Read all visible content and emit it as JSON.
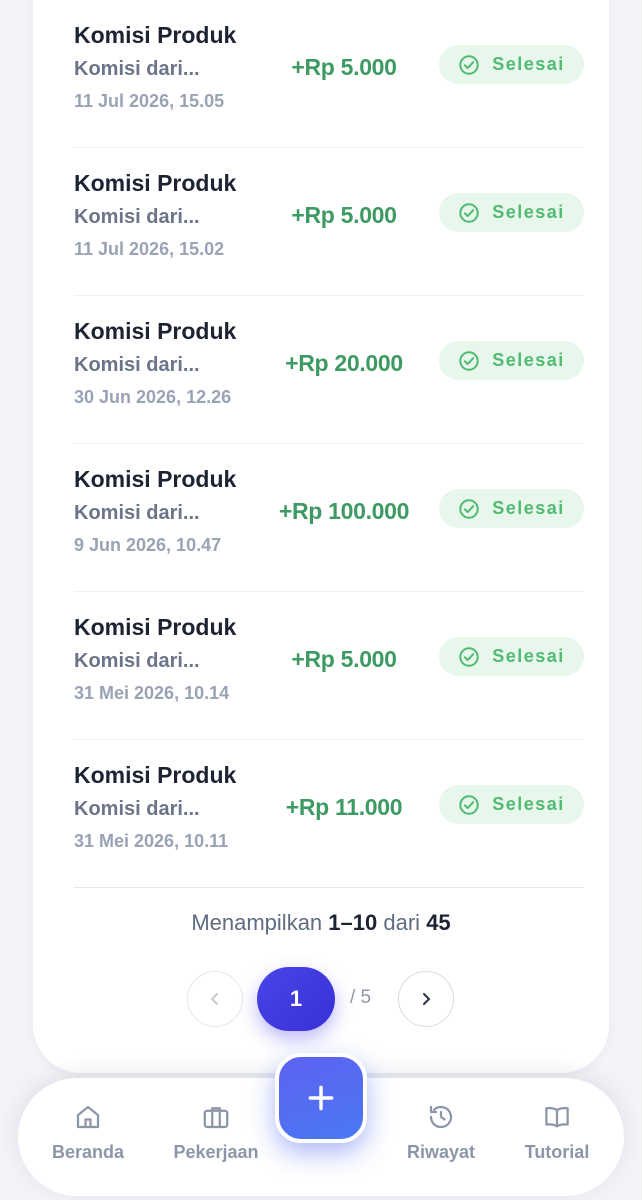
{
  "transactions": [
    {
      "title": "Komisi Produk",
      "desc": "Komisi dari...",
      "time": "11 Jul 2026, 15.05",
      "amount": "+Rp 5.000",
      "status": "Selesai"
    },
    {
      "title": "Komisi Produk",
      "desc": "Komisi dari...",
      "time": "11 Jul 2026, 15.02",
      "amount": "+Rp 5.000",
      "status": "Selesai"
    },
    {
      "title": "Komisi Produk",
      "desc": "Komisi dari...",
      "time": "30 Jun 2026, 12.26",
      "amount": "+Rp 20.000",
      "status": "Selesai"
    },
    {
      "title": "Komisi Produk",
      "desc": "Komisi dari...",
      "time": "9 Jun 2026, 10.47",
      "amount": "+Rp 100.000",
      "status": "Selesai"
    },
    {
      "title": "Komisi Produk",
      "desc": "Komisi dari...",
      "time": "31 Mei 2026, 10.14",
      "amount": "+Rp 5.000",
      "status": "Selesai"
    },
    {
      "title": "Komisi Produk",
      "desc": "Komisi dari...",
      "time": "31 Mei 2026, 10.11",
      "amount": "+Rp 11.000",
      "status": "Selesai"
    }
  ],
  "summary": {
    "prefix": "Menampilkan",
    "range": "1–10",
    "middle": "dari",
    "total": "45"
  },
  "pagination": {
    "current": "1",
    "total_label": "/ 5",
    "prev_icon": "chevron-left-icon",
    "next_icon": "chevron-right-icon"
  },
  "bottom_nav": {
    "items": [
      {
        "label": "Beranda",
        "icon": "home-icon"
      },
      {
        "label": "Pekerjaan",
        "icon": "briefcase-icon"
      },
      {
        "label": "Riwayat",
        "icon": "history-icon"
      },
      {
        "label": "Tutorial",
        "icon": "book-icon"
      }
    ],
    "fab_icon": "plus-icon"
  },
  "colors": {
    "accent": "#3f3ae0",
    "success_text": "#3e9a63",
    "badge_bg": "#e7f7ec",
    "badge_text": "#52ba72",
    "title_text": "#1d2333",
    "muted_text": "#9aa3b5"
  }
}
